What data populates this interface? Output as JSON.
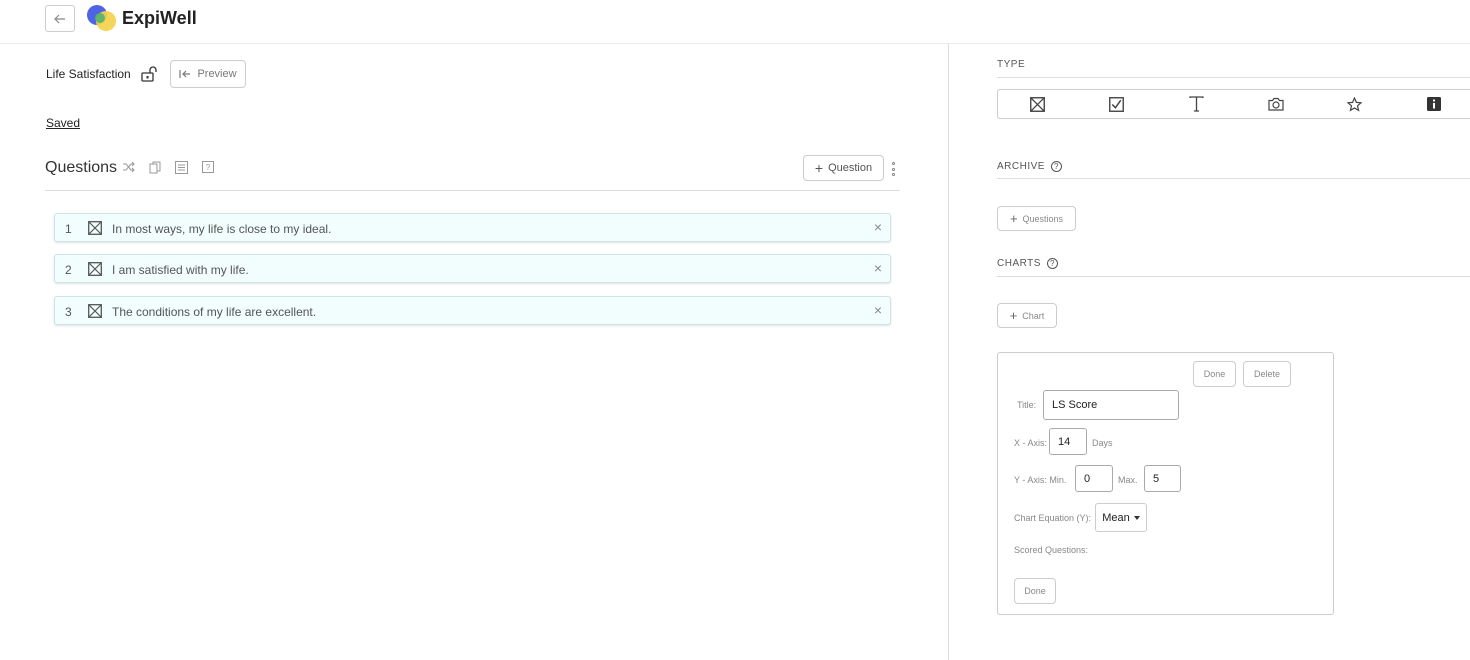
{
  "app": {
    "brand": "ExpiWell"
  },
  "survey": {
    "title": "Life Satisfaction",
    "preview_label": "Preview",
    "saved_label": "Saved"
  },
  "questions": {
    "heading": "Questions",
    "add_label": "Question",
    "items": [
      {
        "number": "1",
        "text": "In most ways, my life is close to my ideal.",
        "type_icon": "multiple-choice-icon"
      },
      {
        "number": "2",
        "text": "I am satisfied with my life.",
        "type_icon": "multiple-choice-icon"
      },
      {
        "number": "3",
        "text": "The conditions of my life are excellent.",
        "type_icon": "multiple-choice-icon"
      }
    ]
  },
  "right_panel": {
    "type_label": "TYPE",
    "type_icons": [
      "multiple-choice-icon",
      "checkbox-icon",
      "text-icon",
      "camera-icon",
      "star-icon",
      "info-icon"
    ],
    "archive_label": "ARCHIVE",
    "add_questions_label": "Questions",
    "charts_label": "CHARTS",
    "add_chart_label": "Chart",
    "chart_editor": {
      "done_label": "Done",
      "delete_label": "Delete",
      "title_label": "Title:",
      "title_value": "LS Score",
      "x_axis_label": "X - Axis:",
      "x_axis_value": "14",
      "x_axis_unit": "Days",
      "y_axis_label": "Y - Axis: Min.",
      "y_min_value": "0",
      "y_max_label": "Max.",
      "y_max_value": "5",
      "equation_label": "Chart Equation (Y):",
      "equation_value": "Mean",
      "scored_label": "Scored Questions:",
      "bottom_done_label": "Done"
    }
  }
}
